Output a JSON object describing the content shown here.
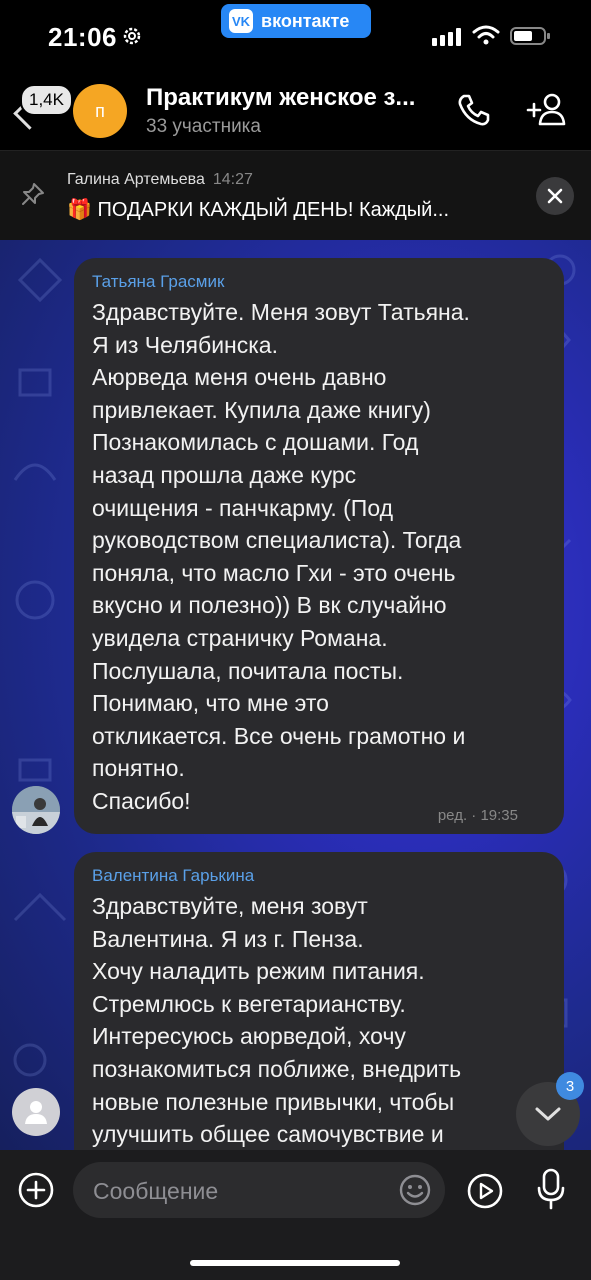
{
  "status_bar": {
    "time": "21:06",
    "app_banner": "вконтакте",
    "app_logo": "VK"
  },
  "header": {
    "back_badge": "1,4K",
    "avatar_letter": "п",
    "title": "Практикум женское з...",
    "subtitle": "33 участника",
    "icons": [
      "phone-icon",
      "add-user-icon"
    ]
  },
  "pinned": {
    "author": "Галина Артемьева",
    "time": "14:27",
    "text": "🎁 ПОДАРКИ КАЖДЫЙ ДЕНЬ! Каждый..."
  },
  "messages": [
    {
      "author": "Татьяна Грасмик",
      "text": "Здравствуйте. Меня зовут Татьяна.\nЯ из Челябинска.\nАюрведа меня очень давно\nпривлекает. Купила даже книгу)\nПознакомилась с дошами. Год\nназад прошла даже курс\nочищения - панчкарму. (Под\nруководством специалиста). Тогда\nпоняла, что масло Гхи - это очень\nвкусно и полезно))  В вк случайно\nувидела страничку Романа.\nПослушала, почитала посты.\nПонимаю, что мне это\nоткликается. Все очень грамотно и\nпонятно.\nСпасибо!",
      "meta": "ред. · 19:35"
    },
    {
      "author": "Валентина Гарькина",
      "text": "Здравствуйте, меня зовут\nВалентина. Я из г. Пенза.\nХочу наладить режим питания.\nСтремлюсь к вегетарианству.\nИнтересуюсь аюрведой, хочу\nпознакомиться поближе, внедрить\nновые полезные привычки, чтобы\nулучшить общее самочувствие и",
      "meta": ""
    }
  ],
  "scroll_down": {
    "unread_count": "3"
  },
  "composer": {
    "placeholder": "Сообщение"
  }
}
